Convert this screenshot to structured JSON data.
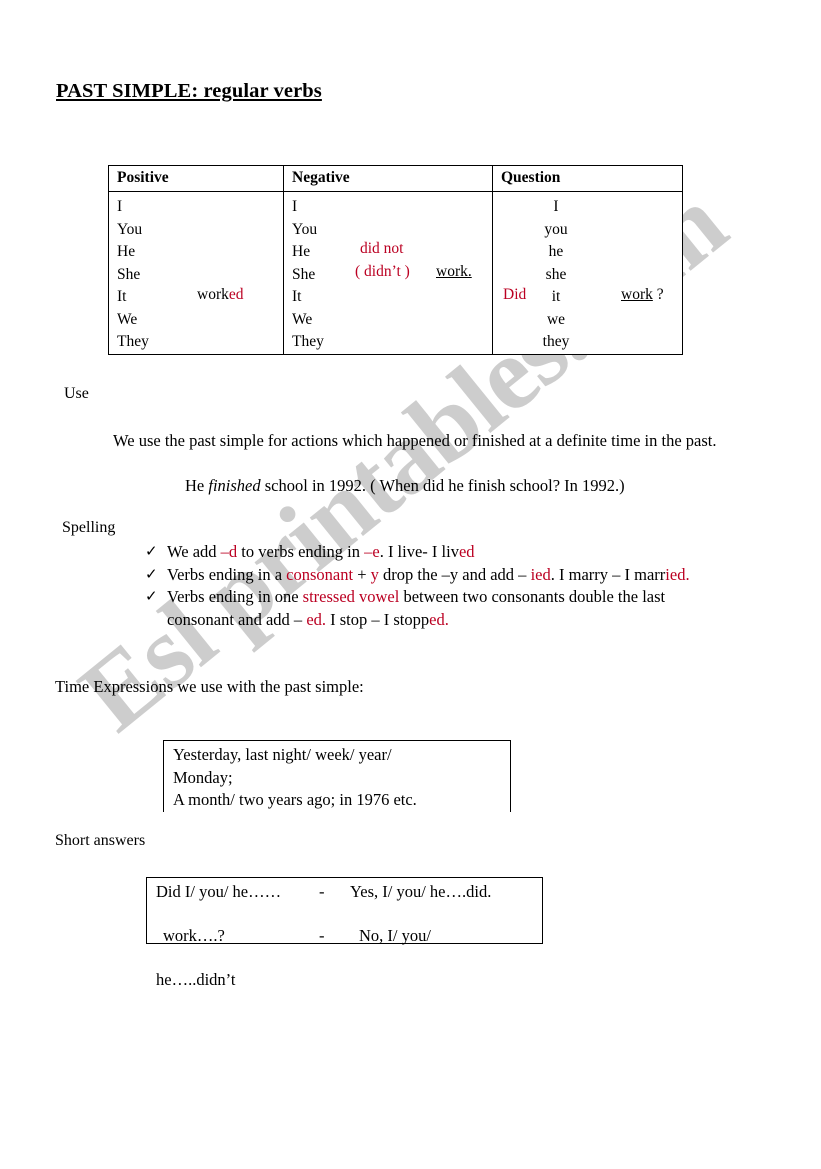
{
  "page": {
    "title": "PAST SIMPLE: regular verbs",
    "watermark": "Esl printables.com",
    "accent_red": "#bb0022",
    "text_color": "#000000",
    "background": "#ffffff"
  },
  "conjugation_table": {
    "headers": [
      "Positive",
      "Negative",
      "Question"
    ],
    "positive": {
      "pronouns": [
        "I",
        "You",
        "He",
        "She",
        "It",
        "We",
        "They"
      ],
      "verb_stem": "work",
      "verb_ending": "ed"
    },
    "negative": {
      "pronouns": [
        "I",
        "You",
        "He",
        "She",
        "It",
        "We",
        "They"
      ],
      "auxiliary": "did not",
      "contraction": "( didn’t )",
      "verb": "work."
    },
    "question": {
      "auxiliary": "Did",
      "pronouns": [
        "I",
        "you",
        "he",
        "she",
        "it",
        "we",
        "they"
      ],
      "verb": "work",
      "question_mark": " ?"
    }
  },
  "use_section": {
    "label": "Use",
    "paragraph": "We use the past simple for actions which happened or finished at a definite time in the past.",
    "example_pre": "He ",
    "example_italic": "finished",
    "example_post": " school in 1992. ( When did he finish school? In 1992.)"
  },
  "spelling_section": {
    "label": "Spelling",
    "bullet_glyph": "✓",
    "rules": [
      {
        "segments": [
          {
            "text": "We add ",
            "color": "black"
          },
          {
            "text": "–d",
            "color": "red"
          },
          {
            "text": " to verbs ending in ",
            "color": "black"
          },
          {
            "text": "–e",
            "color": "red"
          },
          {
            "text": ". I live- I liv",
            "color": "black"
          },
          {
            "text": "ed",
            "color": "red"
          }
        ]
      },
      {
        "segments": [
          {
            "text": "Verbs ending in a ",
            "color": "black"
          },
          {
            "text": "consonant",
            "color": "red"
          },
          {
            "text": " + ",
            "color": "black"
          },
          {
            "text": "y",
            "color": "red"
          },
          {
            "text": " drop the –y and add – ",
            "color": "black"
          },
          {
            "text": "ied",
            "color": "red"
          },
          {
            "text": ". I marry – I marr",
            "color": "black"
          },
          {
            "text": "ied.",
            "color": "red"
          }
        ]
      },
      {
        "segments": [
          {
            "text": "Verbs ending in one ",
            "color": "black"
          },
          {
            "text": "stressed vowel",
            "color": "red"
          },
          {
            "text": " between two consonants double the last consonant and add – ",
            "color": "black"
          },
          {
            "text": "ed.",
            "color": "red"
          },
          {
            "text": " I stop – I stopp",
            "color": "black"
          },
          {
            "text": "ed.",
            "color": "red"
          }
        ]
      }
    ]
  },
  "time_expressions": {
    "intro": "Time Expressions we use with the past simple:",
    "lines": [
      "Yesterday, last night/ week/ year/",
      "Monday;",
      "A month/ two years ago; in 1976 etc."
    ]
  },
  "short_answers": {
    "label": "Short answers",
    "rows": [
      {
        "question": "Did I/ you/ he……",
        "dash": "-",
        "answer": "Yes, I/ you/ he….did."
      },
      {
        "question": " work….?",
        "dash": "-",
        "answer": "No, I/ you/"
      },
      {
        "question": "he…..didn’t",
        "dash": "",
        "answer": ""
      }
    ]
  }
}
